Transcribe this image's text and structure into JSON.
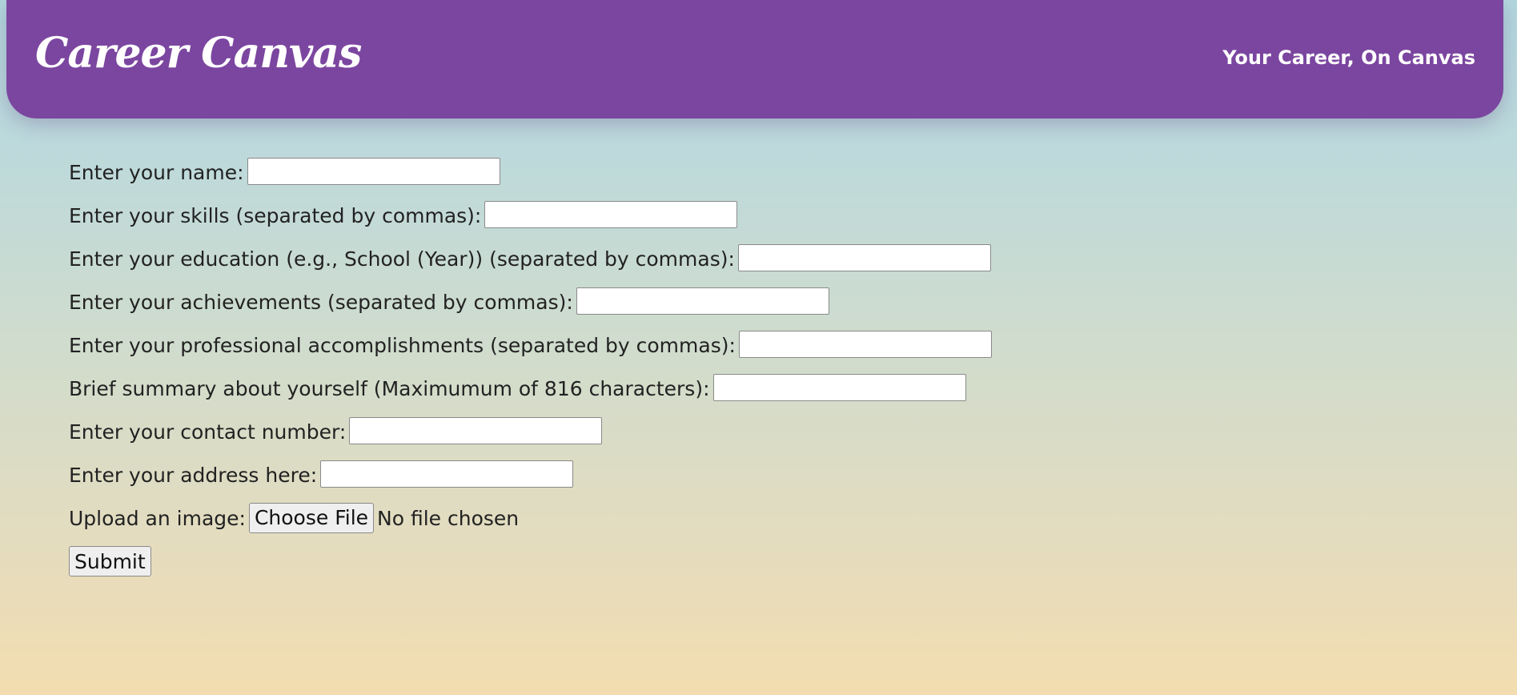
{
  "header": {
    "logo": "Career Canvas",
    "tagline": "Your Career, On Canvas",
    "background_color": "#7b46a0"
  },
  "form": {
    "fields": [
      {
        "label": "Enter your name:",
        "value": ""
      },
      {
        "label": "Enter your skills (separated by commas):",
        "value": ""
      },
      {
        "label": "Enter your education (e.g., School (Year)) (separated by commas):",
        "value": ""
      },
      {
        "label": "Enter your achievements (separated by commas):",
        "value": ""
      },
      {
        "label": "Enter your professional accomplishments (separated by commas):",
        "value": ""
      },
      {
        "label": "Brief summary about yourself (Maximumum of 816 characters):",
        "value": ""
      },
      {
        "label": "Enter your contact number:",
        "value": ""
      },
      {
        "label": "Enter your address here:",
        "value": ""
      }
    ],
    "upload": {
      "label": "Upload an image:",
      "button_label": "Choose File",
      "status": "No file chosen"
    },
    "submit_label": "Submit"
  }
}
